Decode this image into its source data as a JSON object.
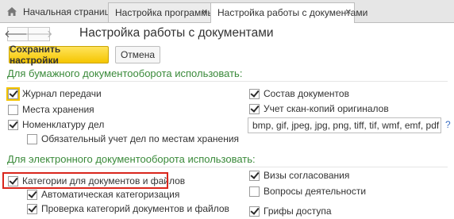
{
  "tabs": {
    "home": "Начальная страница",
    "items": [
      {
        "label": "Настройка программы"
      },
      {
        "label": "Настройка работы с документами"
      }
    ]
  },
  "nav": {
    "back": "🡐",
    "forward": "🡒"
  },
  "page": {
    "title": "Настройка работы с документами"
  },
  "toolbar": {
    "save_label": "Сохранить настройки",
    "cancel_label": "Отмена"
  },
  "paper": {
    "heading": "Для бумажного документооборота использовать:",
    "left": [
      {
        "label": "Журнал передачи",
        "checked": true
      },
      {
        "label": "Места хранения",
        "checked": false
      },
      {
        "label": "Номенклатуру дел",
        "checked": true
      },
      {
        "label": "Обязательный учет дел по местам хранения",
        "checked": false
      }
    ],
    "right": [
      {
        "label": "Состав документов",
        "checked": true
      },
      {
        "label": "Учет скан-копий оригиналов",
        "checked": true
      }
    ],
    "formats": "bmp, gif, jpeg, jpg, png, tiff, tif, wmf, emf, pdf",
    "help": "?"
  },
  "electronic": {
    "heading": "Для электронного документооборота использовать:",
    "left": [
      {
        "label": "Категории для документов и файлов",
        "checked": true
      },
      {
        "label": "Автоматическая категоризация",
        "checked": true
      },
      {
        "label": "Проверка категорий документов и файлов",
        "checked": true
      }
    ],
    "right": [
      {
        "label": "Визы согласования",
        "checked": true
      },
      {
        "label": "Вопросы деятельности",
        "checked": false
      },
      {
        "label": "Грифы доступа",
        "checked": true
      }
    ]
  },
  "colors": {
    "section": "#3a8a3a",
    "primary_button": "#f5c600",
    "highlight": "#d9261c"
  }
}
